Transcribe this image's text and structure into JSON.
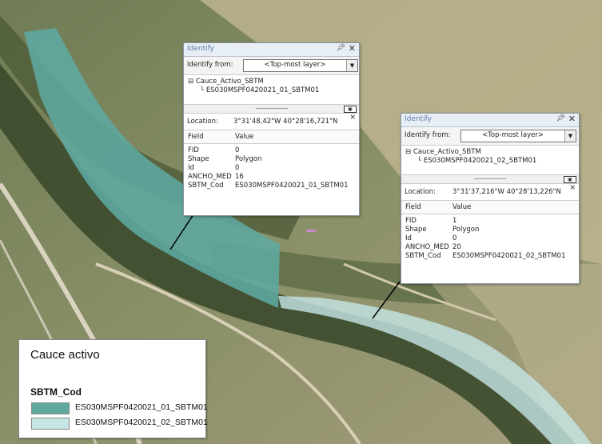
{
  "colors": {
    "segment_01": "#5fa9a0",
    "segment_02": "#c6e6e6"
  },
  "windows": [
    {
      "title": "Identify",
      "pin_icon": "pin-icon",
      "close_icon": "close-icon",
      "identify_from_label": "Identify from:",
      "identify_from_value": "<Top-most layer>",
      "layer": "Cauce_Activo_SBTM",
      "feature": "ES030MSPF0420021_01_SBTM01",
      "location_label": "Location:",
      "location_value": "3°31'48,42\"W  40°28'16,721\"N",
      "field_header": "Field",
      "value_header": "Value",
      "rows": [
        {
          "field": "FID",
          "value": "0"
        },
        {
          "field": "Shape",
          "value": "Polygon"
        },
        {
          "field": "Id",
          "value": "0"
        },
        {
          "field": "ANCHO_MED",
          "value": "16"
        },
        {
          "field": "SBTM_Cod",
          "value": "ES030MSPF0420021_01_SBTM01"
        }
      ]
    },
    {
      "title": "Identify",
      "pin_icon": "pin-icon",
      "close_icon": "close-icon",
      "identify_from_label": "Identify from:",
      "identify_from_value": "<Top-most layer>",
      "layer": "Cauce_Activo_SBTM",
      "feature": "ES030MSPF0420021_02_SBTM01",
      "location_label": "Location:",
      "location_value": "3°31'37,216\"W  40°28'13,226\"N",
      "field_header": "Field",
      "value_header": "Value",
      "rows": [
        {
          "field": "FID",
          "value": "1"
        },
        {
          "field": "Shape",
          "value": "Polygon"
        },
        {
          "field": "Id",
          "value": "0"
        },
        {
          "field": "ANCHO_MED",
          "value": "20"
        },
        {
          "field": "SBTM_Cod",
          "value": "ES030MSPF0420021_02_SBTM01"
        }
      ]
    }
  ],
  "legend": {
    "title": "Cauce activo",
    "field": "SBTM_Cod",
    "items": [
      {
        "label": "ES030MSPF0420021_01_SBTM01"
      },
      {
        "label": "ES030MSPF0420021_02_SBTM01"
      }
    ]
  }
}
